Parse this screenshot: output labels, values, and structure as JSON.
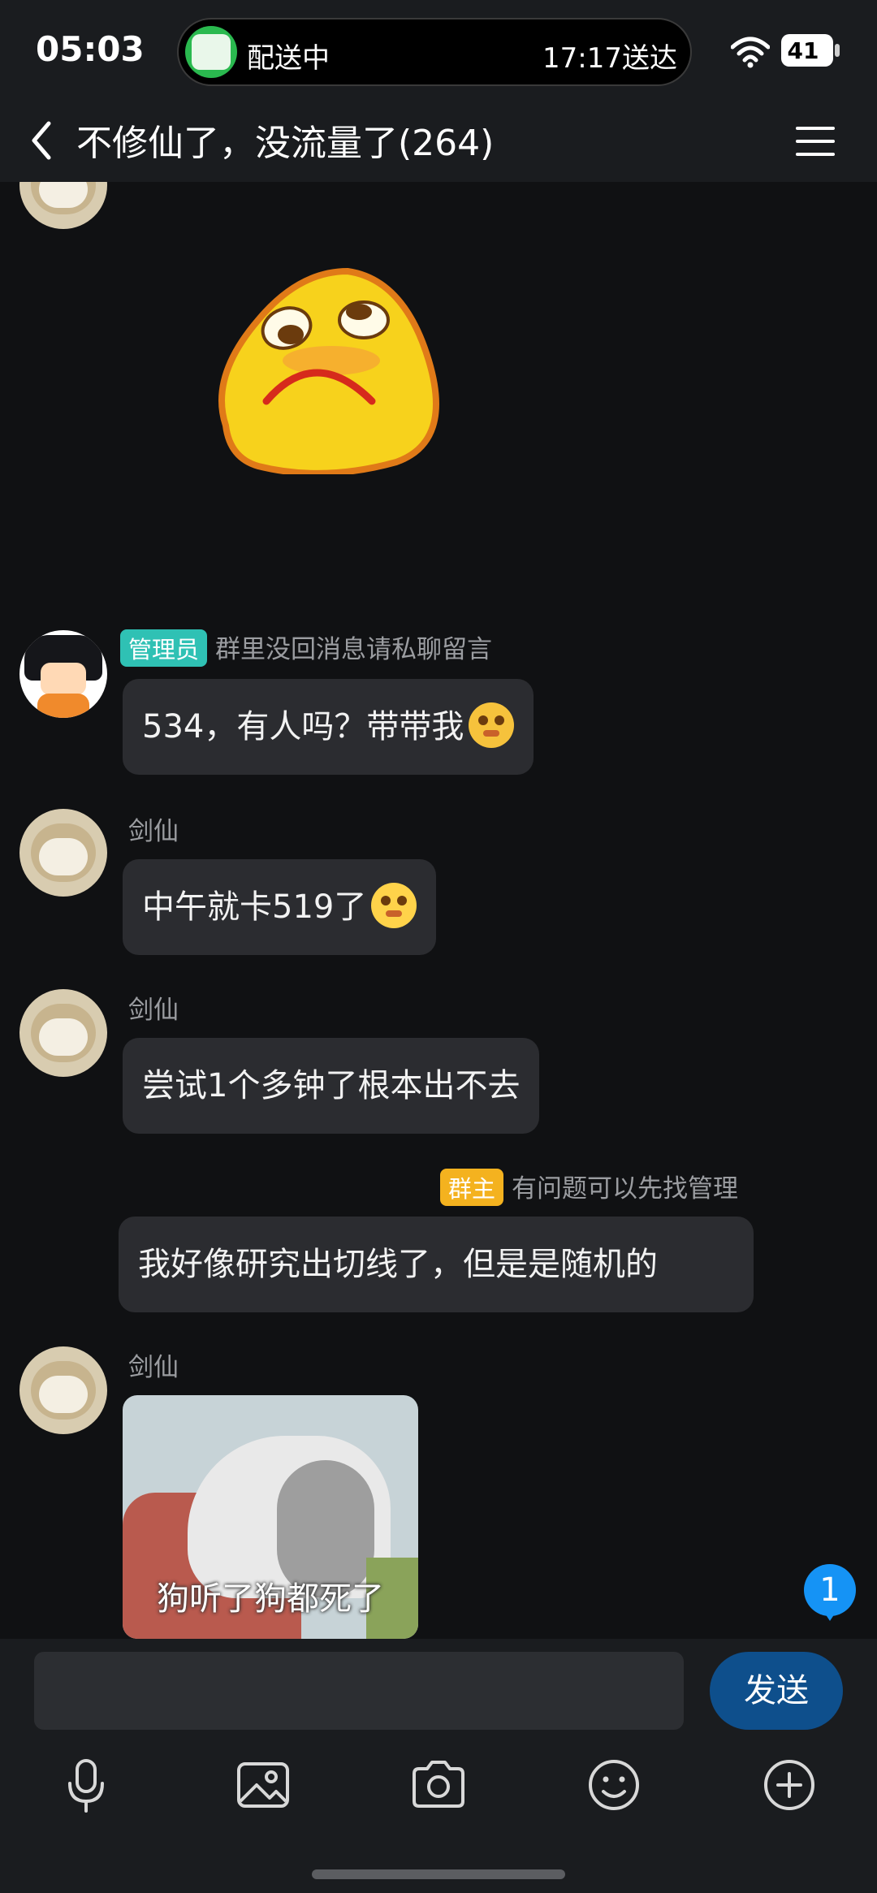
{
  "status_bar": {
    "time": "05:03",
    "island_label": "配送中",
    "island_right": "17:17送达",
    "battery": "41"
  },
  "header": {
    "title": "不修仙了，没流量了(264)"
  },
  "messages": [
    {
      "type": "sticker",
      "sticker": "sad-face"
    },
    {
      "name": "群里没回消息请私聊留言",
      "badge": "管理员",
      "text": "534，有人吗？带带我",
      "emoji": "pondering-emoji"
    },
    {
      "name": "剑仙",
      "text": "中午就卡519了",
      "emoji": "blush-emoji"
    },
    {
      "name": "剑仙",
      "text": "尝试1个多钟了根本出不去"
    },
    {
      "name": "有问题可以先找管理",
      "badge": "群主",
      "text": "我好像研究出切线了，但是是随机的",
      "self": true
    },
    {
      "name": "剑仙",
      "type": "image",
      "caption": "狗听了狗都死了"
    }
  ],
  "unread_count": "1",
  "input": {
    "placeholder": "",
    "send_label": "发送"
  },
  "toolbar": {
    "icons": [
      "microphone-icon",
      "image-icon",
      "camera-icon",
      "emoji-icon",
      "plus-icon"
    ]
  },
  "colors": {
    "background": "#101113",
    "bubble": "#2b2c30",
    "admin_badge": "#2fc1b4",
    "owner_badge": "#f4b21f",
    "send_button": "#0e4f8c",
    "unread": "#1593f5"
  }
}
